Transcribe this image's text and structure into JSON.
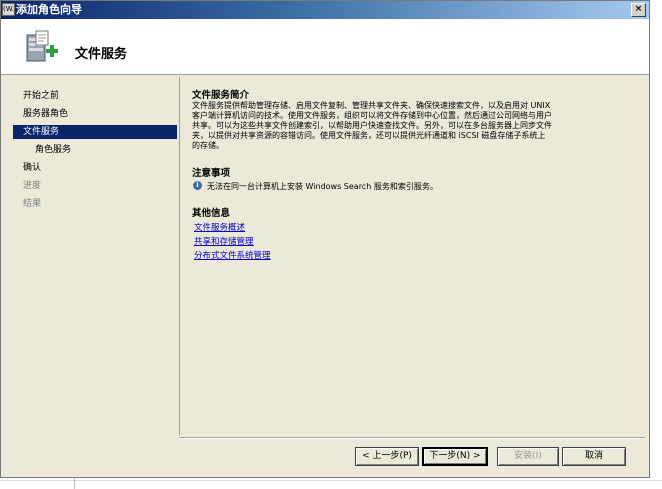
{
  "window": {
    "title": "添加角色向导",
    "title_icon_text": "(W.",
    "close_label": "×"
  },
  "header": {
    "page_title": "文件服务"
  },
  "nav": {
    "items": [
      {
        "label": "开始之前",
        "state": "normal"
      },
      {
        "label": "服务器角色",
        "state": "normal"
      },
      {
        "label": "文件服务",
        "state": "selected"
      },
      {
        "label": "角色服务",
        "state": "normal",
        "sub": true
      },
      {
        "label": "确认",
        "state": "normal"
      },
      {
        "label": "进度",
        "state": "disabled"
      },
      {
        "label": "结果",
        "state": "disabled"
      }
    ]
  },
  "content": {
    "intro_title": "文件服务简介",
    "intro_lines": [
      "文件服务提供帮助管理存储、启用文件复制、管理共享文件夹、确保快速搜索文件，以及启用对 UNIX",
      "客户端计算机访问的技术。使用文件服务，组织可以将文件存储到中心位置，然后通过公司网络与用户",
      "共享。可以为这些共享文件创建索引，以帮助用户快速查找文件。另外，可以在多台服务器上同步文件",
      "夹，以提供对共享资源的容错访问。使用文件服务，还可以提供光纤通道和 iSCSI 磁盘存储子系统上",
      "的存储。"
    ],
    "notes_title": "注意事项",
    "note_text": "无法在同一台计算机上安装 Windows Search 服务和索引服务。",
    "more_title": "其他信息",
    "links": [
      "文件服务概述",
      "共享和存储管理",
      "分布式文件系统管理"
    ]
  },
  "buttons": {
    "back": "< 上一步(P)",
    "next": "下一步(N) >",
    "install": "安装(I)",
    "cancel": "取消"
  },
  "colors": {
    "title_bar_start": "#0a246a",
    "selected_nav": "#0a246a",
    "link": "#0000cc",
    "panel_bg": "#ece9d8"
  }
}
